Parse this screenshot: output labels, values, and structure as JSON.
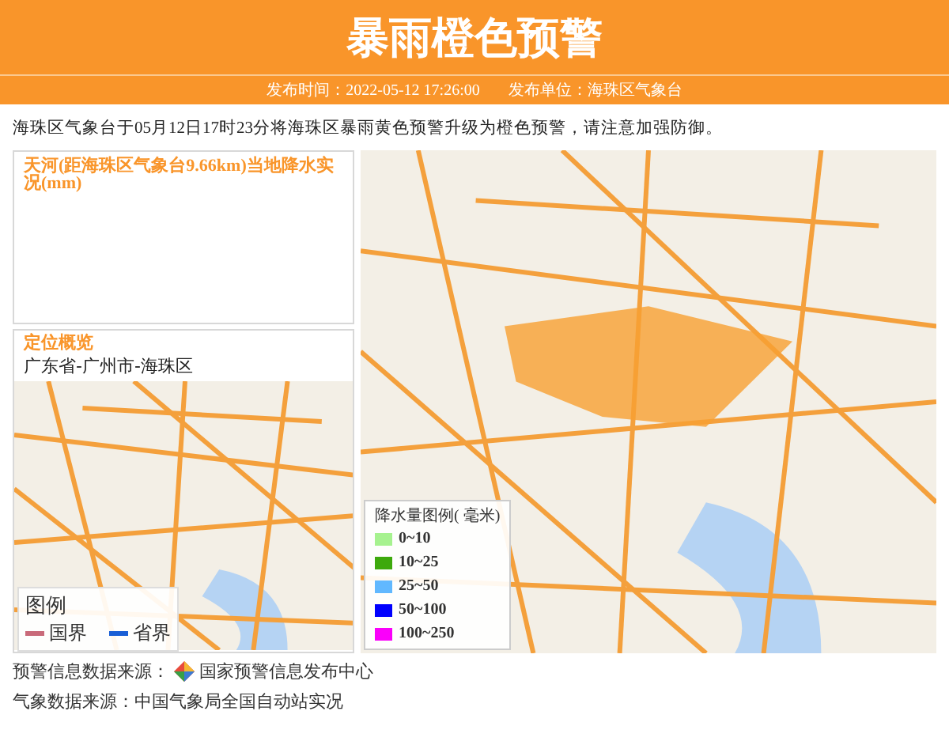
{
  "header": {
    "title": "暴雨橙色预警",
    "publish_time_label": "发布时间：",
    "publish_time": "2022-05-12 17:26:00",
    "publisher_label": "发布单位：",
    "publisher": "海珠区气象台"
  },
  "description": "海珠区气象台于05月12日17时23分将海珠区暴雨黄色预警升级为橙色预警，请注意加强防御。",
  "rain_panel": {
    "title": "天河(距海珠区气象台9.66km)当地降水实况(mm)"
  },
  "location_panel": {
    "title": "定位概览",
    "path": "广东省-广州市-海珠区",
    "legend": {
      "title": "图例",
      "items": [
        {
          "label": "国界",
          "color": "#c96a7a"
        },
        {
          "label": "省界",
          "color": "#1a5fd6"
        }
      ]
    }
  },
  "rain_legend": {
    "title": "降水量图例( 毫米)",
    "items": [
      {
        "label": "0~10",
        "color": "#a6f28f"
      },
      {
        "label": "10~25",
        "color": "#3da90c"
      },
      {
        "label": "25~50",
        "color": "#61b8ff"
      },
      {
        "label": "50~100",
        "color": "#0000fe"
      },
      {
        "label": "100~250",
        "color": "#fa00fa"
      }
    ]
  },
  "footer": {
    "warning_source_label": "预警信息数据来源：",
    "warning_source": "国家预警信息发布中心",
    "weather_source": "气象数据来源：中国气象局全国自动站实况"
  }
}
